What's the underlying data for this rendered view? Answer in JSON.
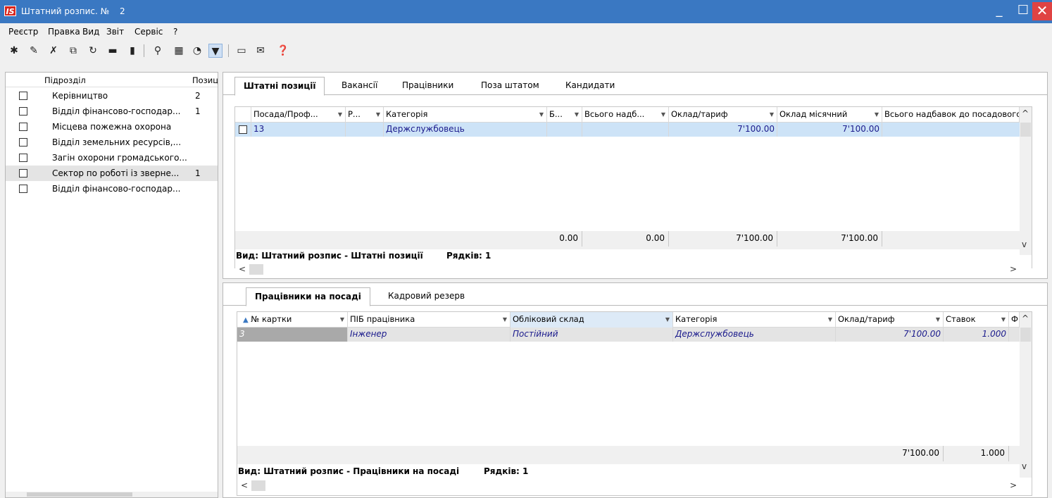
{
  "window": {
    "logo": "IS",
    "title": "Штатний розпис. №",
    "title_number": "2",
    "minimize": "_",
    "maximize": "☐",
    "close": "✕"
  },
  "menu": [
    "Реєстр",
    "Правка",
    "Вид",
    "Звіт",
    "Сервіс",
    "?"
  ],
  "toolbar": {
    "icons": [
      "new-doc-icon",
      "edit-doc-icon",
      "delete-doc-icon",
      "copy-icon",
      "refresh-icon",
      "print-icon",
      "print-preview-icon",
      "search-icon",
      "table-icon",
      "schedule-icon",
      "filter-icon",
      "form-icon",
      "mail-icon",
      "help-icon"
    ]
  },
  "left_panel": {
    "columns": [
      "Підрозділ",
      "Позиц"
    ],
    "rows": [
      {
        "name": "Керівництво",
        "count": "2",
        "selected": false
      },
      {
        "name": "Відділ фінансово-господар...",
        "count": "1",
        "selected": false
      },
      {
        "name": "Місцева пожежна охорона",
        "count": "",
        "selected": false
      },
      {
        "name": "Відділ земельних ресурсів,...",
        "count": "",
        "selected": false
      },
      {
        "name": "Загін охорони громадського...",
        "count": "",
        "selected": false
      },
      {
        "name": "Сектор по роботі із зверне...",
        "count": "1",
        "selected": true
      },
      {
        "name": "Відділ фінансово-господар...",
        "count": "",
        "selected": false
      }
    ]
  },
  "top_panel": {
    "tabs": [
      "Штатні позиції",
      "Вакансії",
      "Працівники",
      "Поза штатом",
      "Кандидати"
    ],
    "active_tab": 0,
    "columns": [
      "Посада/Проф...",
      "Р...",
      "Категорія",
      "Б...",
      "Всього надб...",
      "Оклад/тариф",
      "Оклад місячний",
      "Всього надбавок до посадового"
    ],
    "rows": [
      {
        "position": "13",
        "r": "",
        "category": "Держслужбовець",
        "b": "",
        "total_allow": "",
        "rate": "7'100.00",
        "monthly": "7'100.00",
        "total_allow_pos": ""
      }
    ],
    "totals": {
      "b": "0.00",
      "total_allow": "0.00",
      "rate": "7'100.00",
      "monthly": "7'100.00"
    },
    "status_view": "Вид: Штатний розпис - Штатні позиції",
    "status_rows": "Рядків: 1",
    "scroll_left": "<",
    "scroll_right": ">",
    "scroll_up": "^",
    "scroll_down": "v"
  },
  "bottom_panel": {
    "tabs": [
      "Працівники на посаді",
      "Кадровий резерв"
    ],
    "active_tab": 0,
    "columns": [
      "№ картки",
      "ПІБ працівника",
      "Обліковий склад",
      "Категорія",
      "Оклад/тариф",
      "Ставок",
      "Ф"
    ],
    "rows": [
      {
        "card": "3",
        "name": "Інженер",
        "staff": "Постійний",
        "category": "Держслужбовець",
        "rate": "7'100.00",
        "stakes": "1.000"
      }
    ],
    "totals": {
      "rate": "7'100.00",
      "stakes": "1.000"
    },
    "status_view": "Вид: Штатний розпис - Працівники на посаді",
    "status_rows": "Рядків: 1",
    "sort_icon": "▲"
  }
}
